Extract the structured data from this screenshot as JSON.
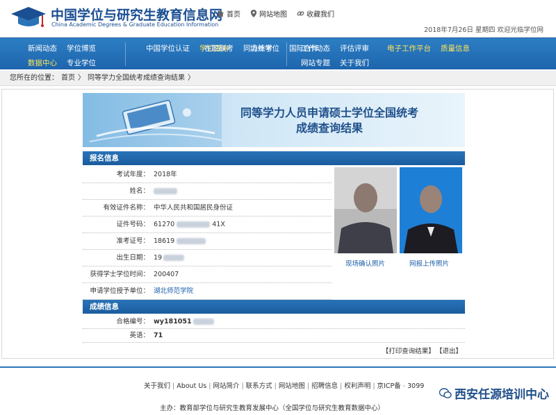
{
  "header": {
    "site_name_cn": "中国学位与研究生教育信息网",
    "site_name_en": "China Academic Degrees & Graduate Education Information",
    "links": [
      "首页",
      "网站地图",
      "收藏我们"
    ],
    "date_line": "2018年7月26日  星期四  欢迎光临学位网"
  },
  "nav": {
    "groups": [
      {
        "row1": [
          "新闻动态",
          "学位博览"
        ],
        "row2": [
          "数据中心",
          "专业学位"
        ],
        "highlight": "数据中心"
      },
      {
        "row1": [
          "中国学位认证"
        ],
        "row2": [
          "学位查询"
        ],
        "highlight": "学位查询"
      },
      {
        "row1": [
          "在职联考"
        ],
        "row2": [
          "同力统考"
        ]
      },
      {
        "row1": [
          "境外学位"
        ],
        "row2": [
          "国际合作"
        ]
      },
      {
        "row1": [
          "工作动态",
          "评估评审"
        ],
        "row2": [
          "网站专题",
          "关于我们"
        ]
      },
      {
        "row1": [
          "电子工作平台"
        ],
        "row2": [
          "质量信息"
        ],
        "highlight_all": true
      }
    ]
  },
  "breadcrumb": {
    "prefix": "您所在的位置：",
    "home": "首页",
    "arrow": "〉",
    "current": "同等学力全国统考成绩查询结果",
    "end": "〉"
  },
  "banner": {
    "title_line1": "同等学力人员申请硕士学位全国统考",
    "title_line2": "成绩查询结果"
  },
  "registration": {
    "section_title": "报名信息",
    "rows": [
      {
        "label": "考试年度：",
        "value": "2018年"
      },
      {
        "label": "姓名：",
        "value": ""
      },
      {
        "label": "有效证件名称：",
        "value": "中华人民共和国居民身份证"
      },
      {
        "label": "证件号码：",
        "value": "61270",
        "suffix": "41X"
      },
      {
        "label": "准考证号：",
        "value": "18619"
      },
      {
        "label": "出生日期：",
        "value": "19"
      },
      {
        "label": "获得学士学位时间：",
        "value": "200407"
      },
      {
        "label": "申请学位授予单位：",
        "value": "湖北师范学院"
      }
    ],
    "photo_onsite_caption": "现场确认照片",
    "photo_online_caption": "网报上传照片"
  },
  "scores": {
    "section_title": "成绩信息",
    "rows": [
      {
        "label": "合格编号：",
        "value": "wy181051"
      },
      {
        "label": "英语：",
        "value": "71"
      }
    ]
  },
  "actions": {
    "print": "【打印查询结果】",
    "exit": "【退出】"
  },
  "footer": {
    "links": [
      "关于我们",
      "About Us",
      "网站简介",
      "联系方式",
      "网站地图",
      "招聘信息",
      "权利声明",
      "京ICP备",
      "3099"
    ],
    "host": "主办：教育部学位与研究生教育发展中心（全国学位与研究生教育数据中心）",
    "watermark": "西安任源培训中心"
  },
  "colors": {
    "nav_blue": "#1d65ad",
    "highlight_yellow": "#ffe55a",
    "link_blue": "#1a5ca8",
    "title_blue": "#1f4f8a"
  }
}
